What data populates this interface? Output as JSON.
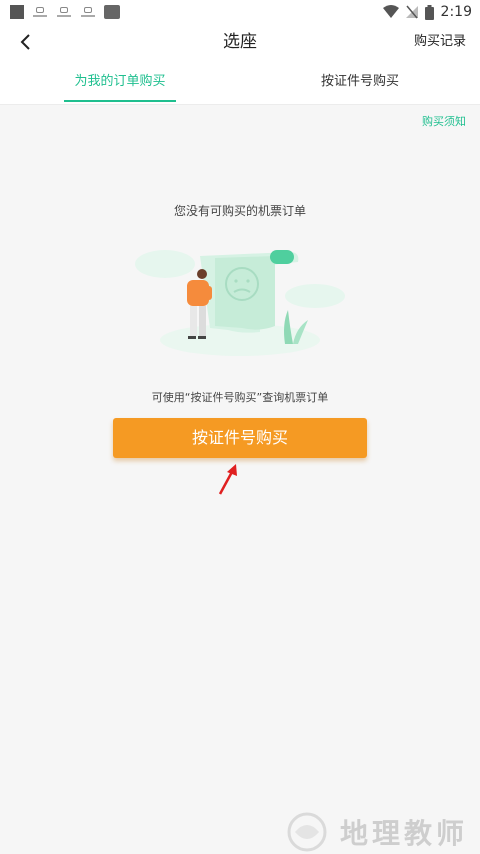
{
  "status_bar": {
    "time": "2:19"
  },
  "header": {
    "title": "选座",
    "right_link": "购买记录",
    "back_icon": "chevron-left-icon"
  },
  "tabs": [
    {
      "label": "为我的订单购买",
      "active": true
    },
    {
      "label": "按证件号购买",
      "active": false
    }
  ],
  "notice_link": "购买须知",
  "empty_state": {
    "message": "您没有可购买的机票订单",
    "illustration": "person-with-ticket-illustration",
    "hint": "可使用“按证件号购买”查询机票订单"
  },
  "primary_button": {
    "label": "按证件号购买",
    "color": "#f59a23"
  },
  "annotation": {
    "icon": "red-arrow-icon",
    "color": "#e02020"
  },
  "watermark": {
    "text": "地理教师"
  },
  "colors": {
    "accent": "#1fbf8f",
    "button": "#f59a23",
    "background": "#f6f6f6"
  }
}
